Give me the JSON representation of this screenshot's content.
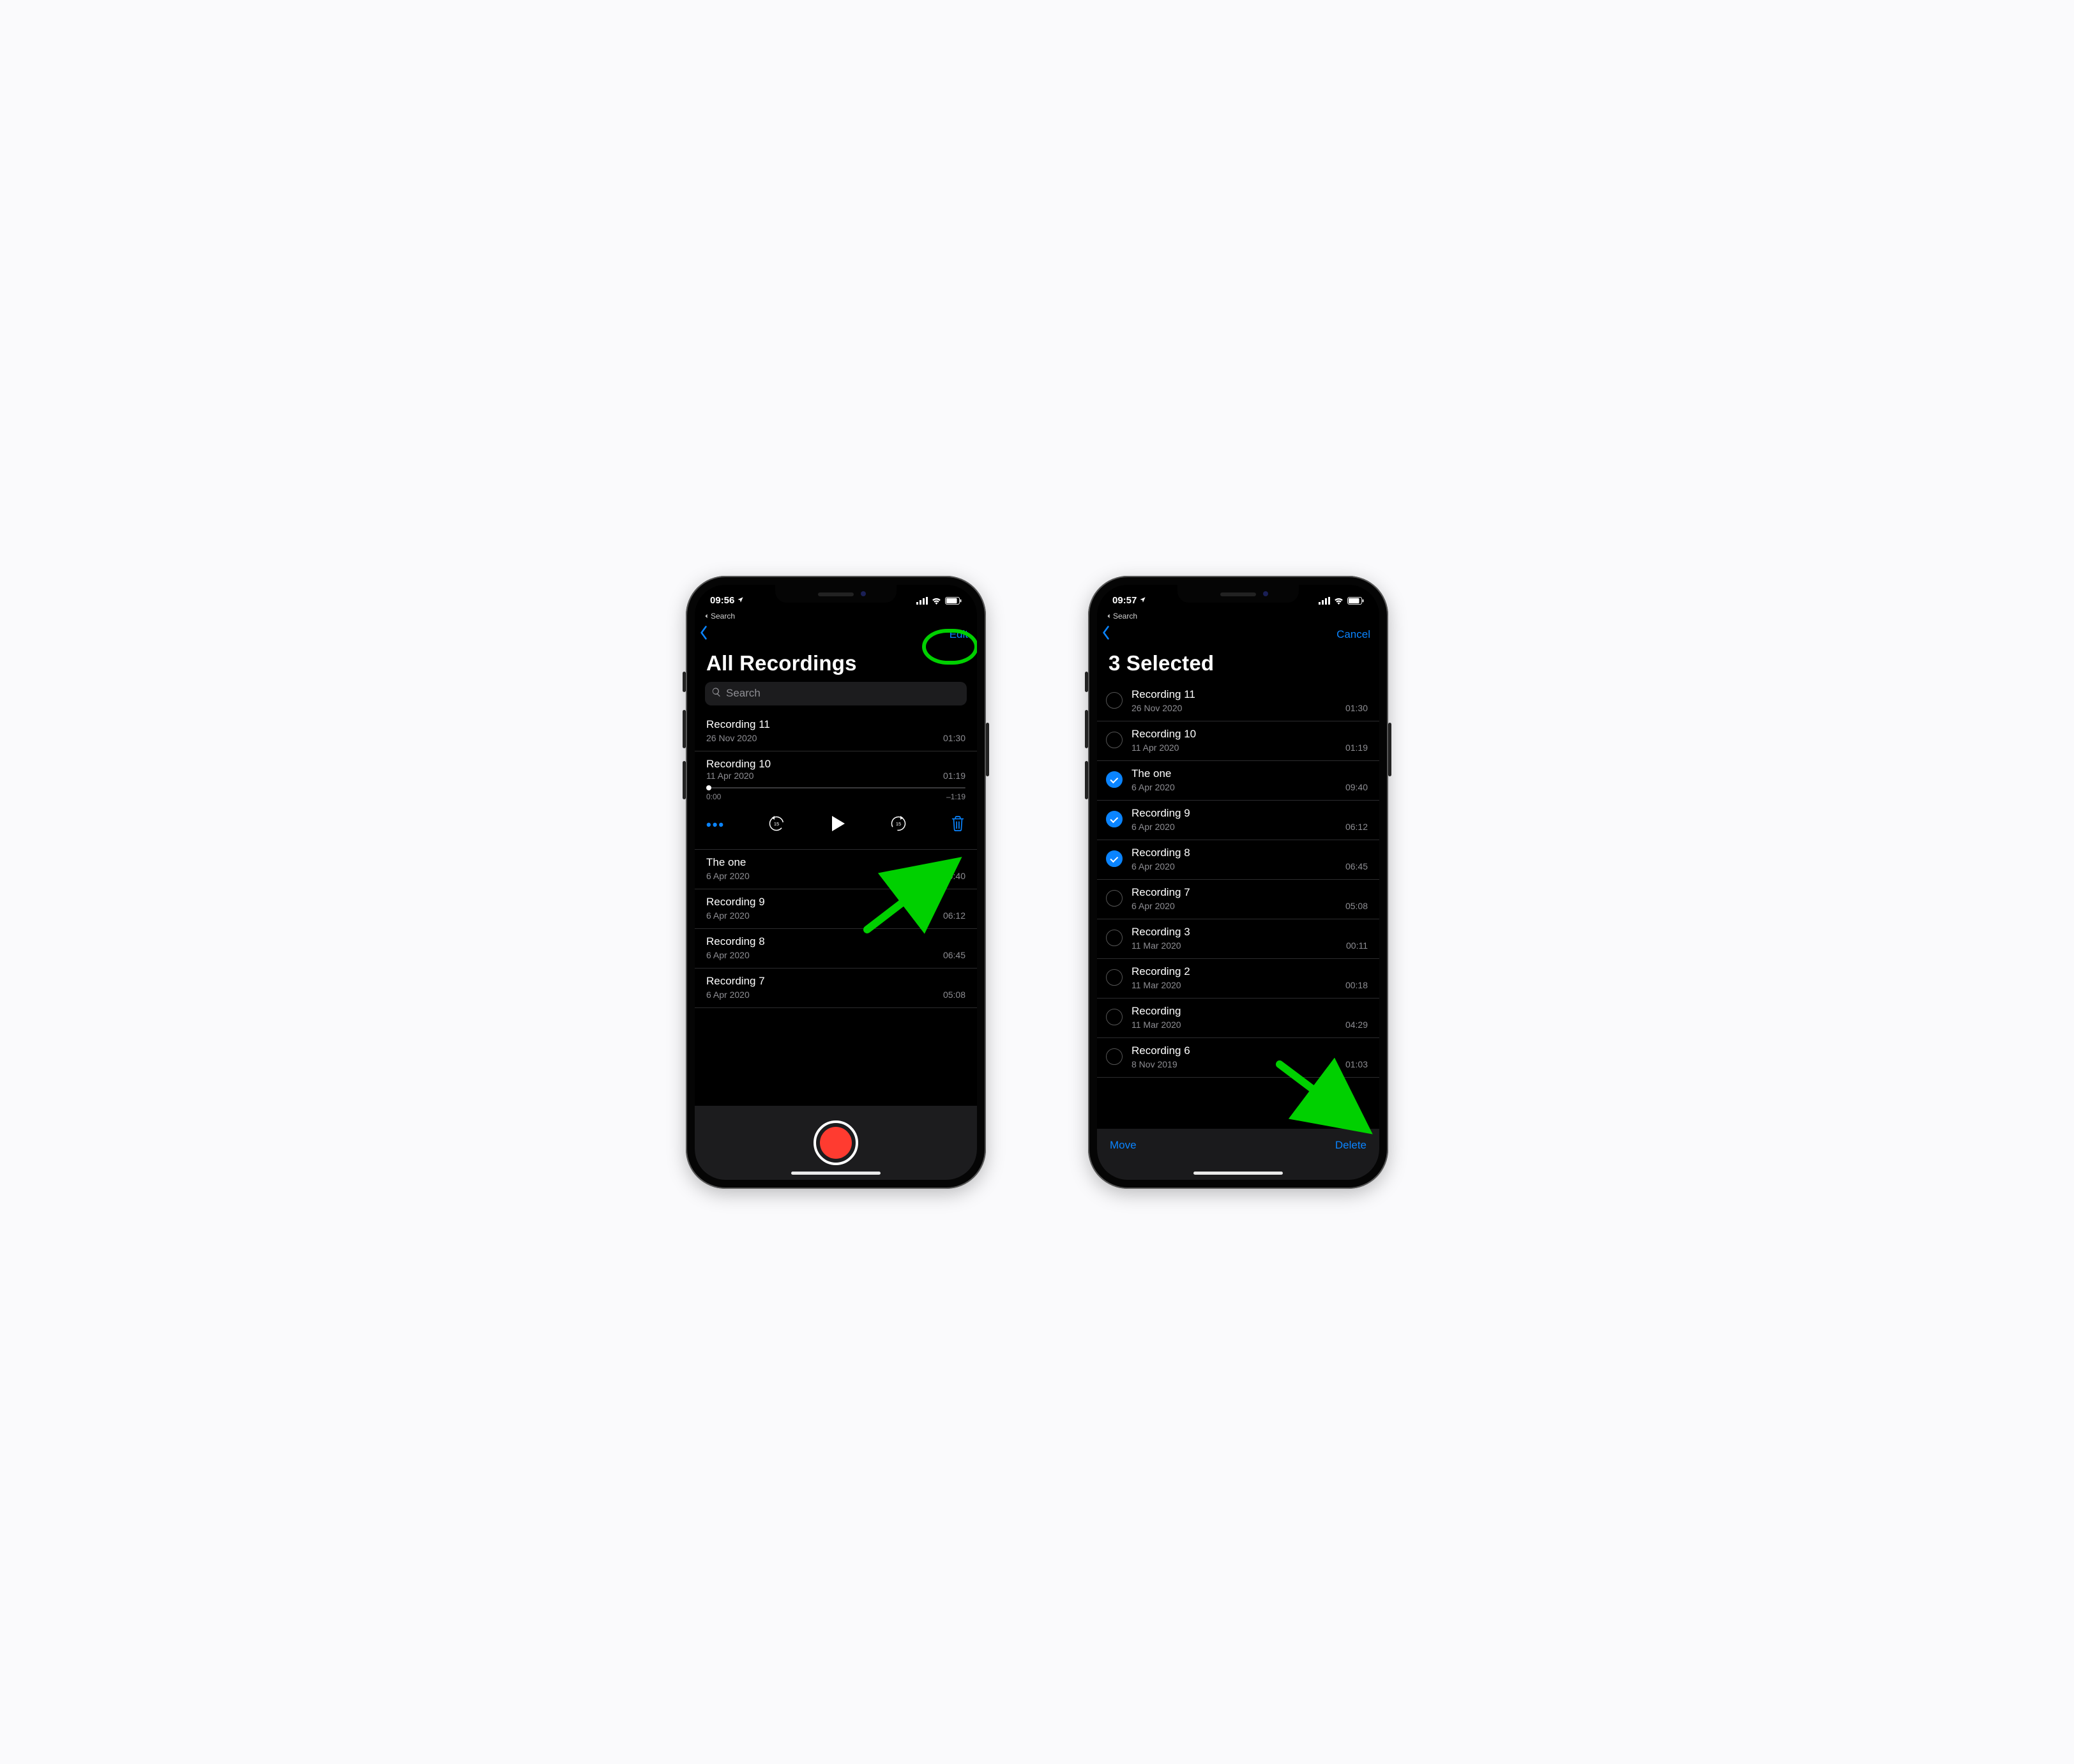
{
  "leftPhone": {
    "status": {
      "time": "09:56",
      "breadcrumb": "Search"
    },
    "nav": {
      "edit": "Edit"
    },
    "title": "All Recordings",
    "search": {
      "placeholder": "Search"
    },
    "player": {
      "name": "Recording 10",
      "date": "11 Apr 2020",
      "duration": "01:19",
      "scrub_start": "0:00",
      "scrub_end": "–1:19"
    },
    "topItems": [
      {
        "name": "Recording 11",
        "date": "26 Nov 2020",
        "dur": "01:30"
      }
    ],
    "items": [
      {
        "name": "The one",
        "date": "6 Apr 2020",
        "dur": "09:40"
      },
      {
        "name": "Recording 9",
        "date": "6 Apr 2020",
        "dur": "06:12"
      },
      {
        "name": "Recording 8",
        "date": "6 Apr 2020",
        "dur": "06:45"
      },
      {
        "name": "Recording 7",
        "date": "6 Apr 2020",
        "dur": "05:08"
      }
    ]
  },
  "rightPhone": {
    "status": {
      "time": "09:57",
      "breadcrumb": "Search"
    },
    "nav": {
      "cancel": "Cancel"
    },
    "title": "3 Selected",
    "items": [
      {
        "name": "Recording 11",
        "date": "26 Nov 2020",
        "dur": "01:30",
        "sel": false
      },
      {
        "name": "Recording 10",
        "date": "11 Apr 2020",
        "dur": "01:19",
        "sel": false
      },
      {
        "name": "The one",
        "date": "6 Apr 2020",
        "dur": "09:40",
        "sel": true
      },
      {
        "name": "Recording 9",
        "date": "6 Apr 2020",
        "dur": "06:12",
        "sel": true
      },
      {
        "name": "Recording 8",
        "date": "6 Apr 2020",
        "dur": "06:45",
        "sel": true
      },
      {
        "name": "Recording 7",
        "date": "6 Apr 2020",
        "dur": "05:08",
        "sel": false
      },
      {
        "name": "Recording 3",
        "date": "11 Mar 2020",
        "dur": "00:11",
        "sel": false
      },
      {
        "name": "Recording 2",
        "date": "11 Mar 2020",
        "dur": "00:18",
        "sel": false
      },
      {
        "name": "Recording",
        "date": "11 Mar 2020",
        "dur": "04:29",
        "sel": false
      },
      {
        "name": "Recording 6",
        "date": "8 Nov 2019",
        "dur": "01:03",
        "sel": false
      }
    ],
    "actions": {
      "move": "Move",
      "delete": "Delete"
    }
  }
}
